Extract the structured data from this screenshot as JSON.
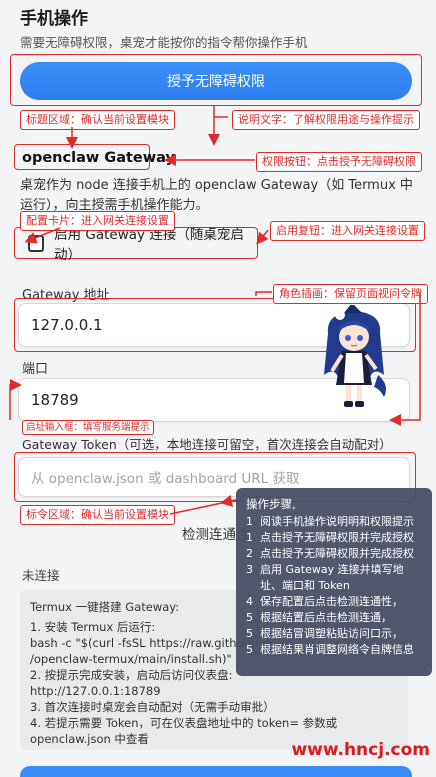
{
  "section": {
    "title": "手机操作",
    "desc": "需要无障碍权限，桌宠才能按你的指令帮你操作手机"
  },
  "grant_button": {
    "label": "授予无障碍权限"
  },
  "gateway": {
    "title": "openclaw Gateway",
    "desc": "桌宠作为 node 连接手机上的 openclaw Gateway（如 Termux 中运行），向主授需手机操作能力。",
    "enable_label": "启用 Gateway 连接（随桌宠启动）",
    "address_label": "Gateway 地址",
    "address_value": "127.0.0.1",
    "port_label": "端口",
    "port_value": "18789",
    "token_label": "Gateway Token（可选，本地连接可留空，首次连接会自动配对）",
    "token_placeholder": "从 openclaw.json 或 dashboard URL 获取",
    "test_label": "检测连通性",
    "status_text": "未连接"
  },
  "guide": {
    "title": "Termux 一键搭建 Gateway:",
    "lines": [
      "1. 安装 Termux 后运行:",
      " bash -c \"$(curl -fsSL https://raw.githubuse",
      "/openclaw-termux/main/install.sh)\"",
      "2. 按提示完成安装，启动后访问仪表盘:",
      " http://127.0.0.1:18789",
      "3. 首次连接时桌宠会自动配对（无需手动审批）",
      "4. 若提示需要 Token，可在仪表盘地址中的 token= 参数或 openclaw.json 中查看"
    ]
  },
  "annotations": {
    "title_area": "标题区域：确认当前设置模块",
    "desc_text": "说明文字：了解权限用途与操作提示",
    "perm_button": "权限按钮：点击授予无障碍权限",
    "config_card": "配置卡片：进入网关连接设置",
    "enable_checkbox": "启用复钮：进入网关连接设置",
    "character": "角色插画：保留页面视问令牌",
    "input_box": "启址输入框：填写服务端提示",
    "token_area": "标令区域：确认当前设置模块"
  },
  "steps": {
    "title": "操作步骤,",
    "items": [
      {
        "num": "1",
        "text": "阅读手机操作说明明和权限提示"
      },
      {
        "num": "1",
        "text": "点击授予无障碍权限并完成授权"
      },
      {
        "num": "2",
        "text": "点击授予无障碍权限并完成授权"
      },
      {
        "num": "3",
        "text": "启用 Gateway 连接并填写地址、端口和 Token"
      },
      {
        "num": "4",
        "text": "保存配置后点击检测连通性，"
      },
      {
        "num": "5",
        "text": "根据结置后点击检测连通，"
      },
      {
        "num": "5",
        "text": "根据结冒调塑粘贴访问口示，"
      },
      {
        "num": "5",
        "text": "根据结果肖调整网络令自牌信息"
      }
    ]
  },
  "watermark": "www.hncj.com",
  "colors": {
    "accent": "#2c7ef0",
    "annotation": "#e02b2b",
    "watermark": "#e01818",
    "tooltip_bg": "#464e64"
  }
}
